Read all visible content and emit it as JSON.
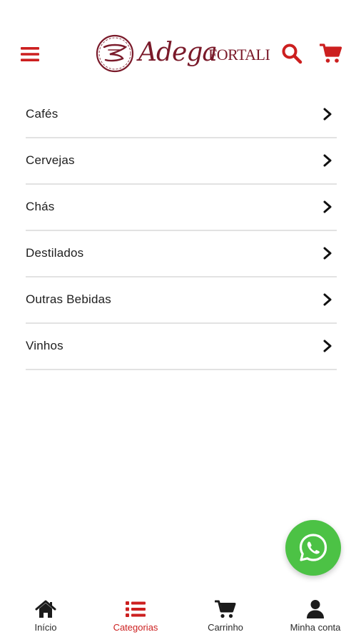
{
  "colors": {
    "accent": "#cc1f1f",
    "brand": "#7a1a2a",
    "whatsapp": "#4cc245",
    "divider": "#e2e2e2",
    "text": "#1e1e1e"
  },
  "header": {
    "logo": {
      "script": "Adega",
      "caps": "FORTALI"
    },
    "icons": [
      "menu-icon",
      "search-icon",
      "cart-icon"
    ]
  },
  "categories": [
    {
      "label": "Cafés"
    },
    {
      "label": "Cervejas"
    },
    {
      "label": "Chás"
    },
    {
      "label": "Destilados"
    },
    {
      "label": "Outras Bebidas"
    },
    {
      "label": "Vinhos"
    }
  ],
  "fab": {
    "icon": "whatsapp-icon"
  },
  "bottom_nav": {
    "active": "categorias",
    "items": [
      {
        "label": "Início",
        "icon": "home-icon"
      },
      {
        "label": "Categorias",
        "icon": "list-icon"
      },
      {
        "label": "Carrinho",
        "icon": "cart-icon"
      },
      {
        "label": "Minha conta",
        "icon": "user-icon"
      }
    ]
  }
}
